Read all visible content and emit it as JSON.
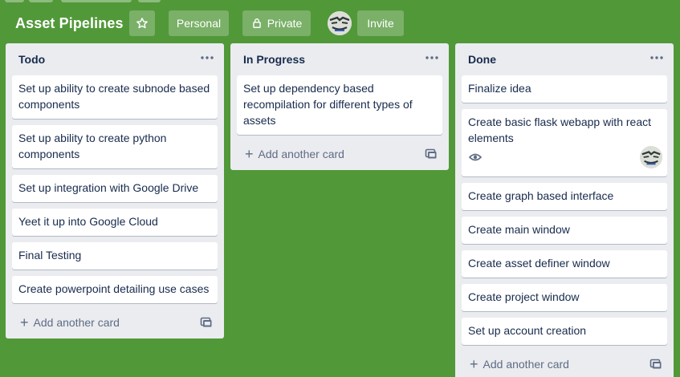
{
  "board": {
    "title": "Asset Pipelines",
    "visibility_team": "Personal",
    "visibility_privacy": "Private",
    "invite_label": "Invite"
  },
  "colors": {
    "background": "#519839",
    "list_bg": "#ebecf0",
    "card_bg": "#ffffff",
    "text": "#172b4d",
    "muted": "#5e6c84"
  },
  "lists": [
    {
      "title": "Todo",
      "add_label": "Add another card",
      "cards": [
        "Set up ability to create subnode based components",
        "Set up ability to create python components",
        "Set up integration with Google Drive",
        "Yeet it up into Google Cloud",
        "Final Testing",
        "Create powerpoint detailing use cases"
      ]
    },
    {
      "title": "In Progress",
      "add_label": "Add another card",
      "cards": [
        "Set up dependency based recompilation for different types of assets"
      ]
    },
    {
      "title": "Done",
      "add_label": "Add another card",
      "cards": [
        "Finalize idea",
        "Create basic flask webapp with react elements",
        "Create graph based interface",
        "Create main window",
        "Create asset definer window",
        "Create project window",
        "Set up account creation"
      ]
    }
  ]
}
